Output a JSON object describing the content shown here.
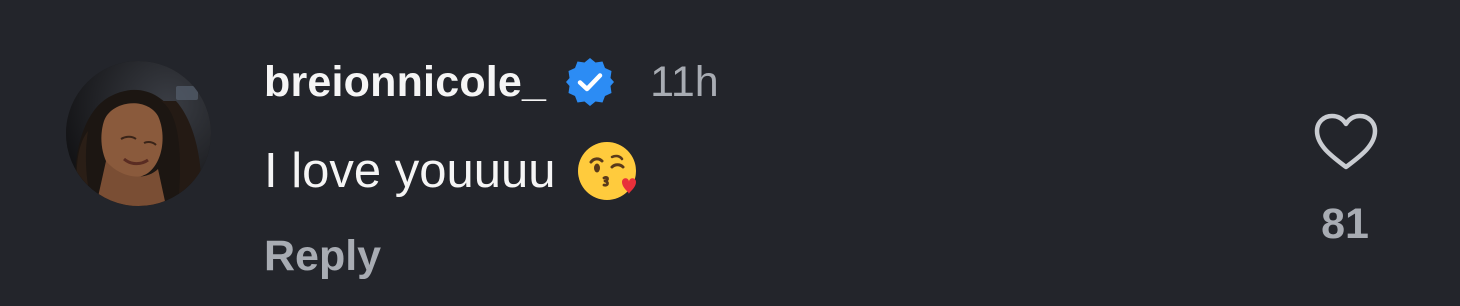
{
  "comment": {
    "username": "breionnicole_",
    "verified_icon": "verified-badge-icon",
    "timestamp": "11h",
    "text": "I love youuuu",
    "emoji": "face-blowing-a-kiss-emoji",
    "reply_label": "Reply",
    "like_icon": "heart-outline-icon",
    "like_count": "81"
  },
  "colors": {
    "background": "#23252b",
    "primary_text": "#f5f5f5",
    "secondary_text": "#a8acb3",
    "verified_blue": "#2c8cf4"
  }
}
